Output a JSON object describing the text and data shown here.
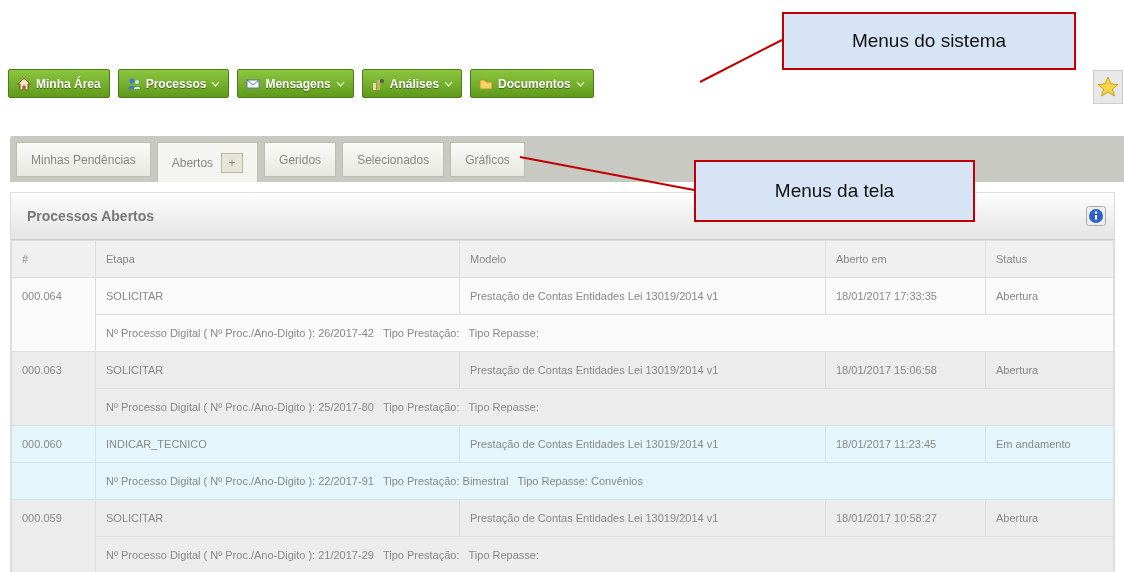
{
  "menu": [
    {
      "label": "Minha Área",
      "dropdown": false
    },
    {
      "label": "Processos",
      "dropdown": true
    },
    {
      "label": "Mensagens",
      "dropdown": true
    },
    {
      "label": "Análises",
      "dropdown": true
    },
    {
      "label": "Documentos",
      "dropdown": true
    }
  ],
  "tabs": [
    {
      "label": "Minhas Pendências",
      "selected": false
    },
    {
      "label": "Abertos",
      "selected": true,
      "add_button": "+"
    },
    {
      "label": "Geridos",
      "selected": false
    },
    {
      "label": "Selecionados",
      "selected": false
    },
    {
      "label": "Gráficos",
      "selected": false
    }
  ],
  "panel": {
    "title": "Processos Abertos"
  },
  "table": {
    "columns": [
      "#",
      "Etapa",
      "Modelo",
      "Aberto em",
      "Status"
    ],
    "rows": [
      {
        "selected": false,
        "cells": [
          "000.064",
          "SOLICITAR",
          "Prestação de Contas Entidades Lei 13019/2014 v1",
          "18/01/2017 17:33:35",
          "Abertura"
        ],
        "detail": [
          "Nº Processo Digital ( Nº Proc./Ano-Digito ): 26/2017-42",
          "Tipo Prestação:",
          "Tipo Repasse:"
        ]
      },
      {
        "selected": false,
        "cells": [
          "000.063",
          "SOLICITAR",
          "Prestação de Contas Entidades Lei 13019/2014 v1",
          "18/01/2017 15:06:58",
          "Abertura"
        ],
        "detail": [
          "Nº Processo Digital ( Nº Proc./Ano-Digito ): 25/2017-80",
          "Tipo Prestação:",
          "Tipo Repasse:"
        ]
      },
      {
        "selected": true,
        "cells": [
          "000.060",
          "INDICAR_TECNICO",
          "Prestação de Contas Entidades Lei 13019/2014 v1",
          "18/01/2017 11:23:45",
          "Em andamento"
        ],
        "detail": [
          "Nº Processo Digital ( Nº Proc./Ano-Digito ): 22/2017-91",
          "Tipo Prestação: Bimestral",
          "Tipo Repasse: Convênios"
        ]
      },
      {
        "selected": false,
        "cells": [
          "000.059",
          "SOLICITAR",
          "Prestação de Contas Entidades Lei 13019/2014 v1",
          "18/01/2017 10:58:27",
          "Abertura"
        ],
        "detail": [
          "Nº Processo Digital ( Nº Proc./Ano-Digito ): 21/2017-29",
          "Tipo Prestação:",
          "Tipo Repasse:"
        ]
      }
    ]
  },
  "callouts": [
    {
      "text": "Menus do sistema"
    },
    {
      "text": "Menus da tela"
    }
  ]
}
